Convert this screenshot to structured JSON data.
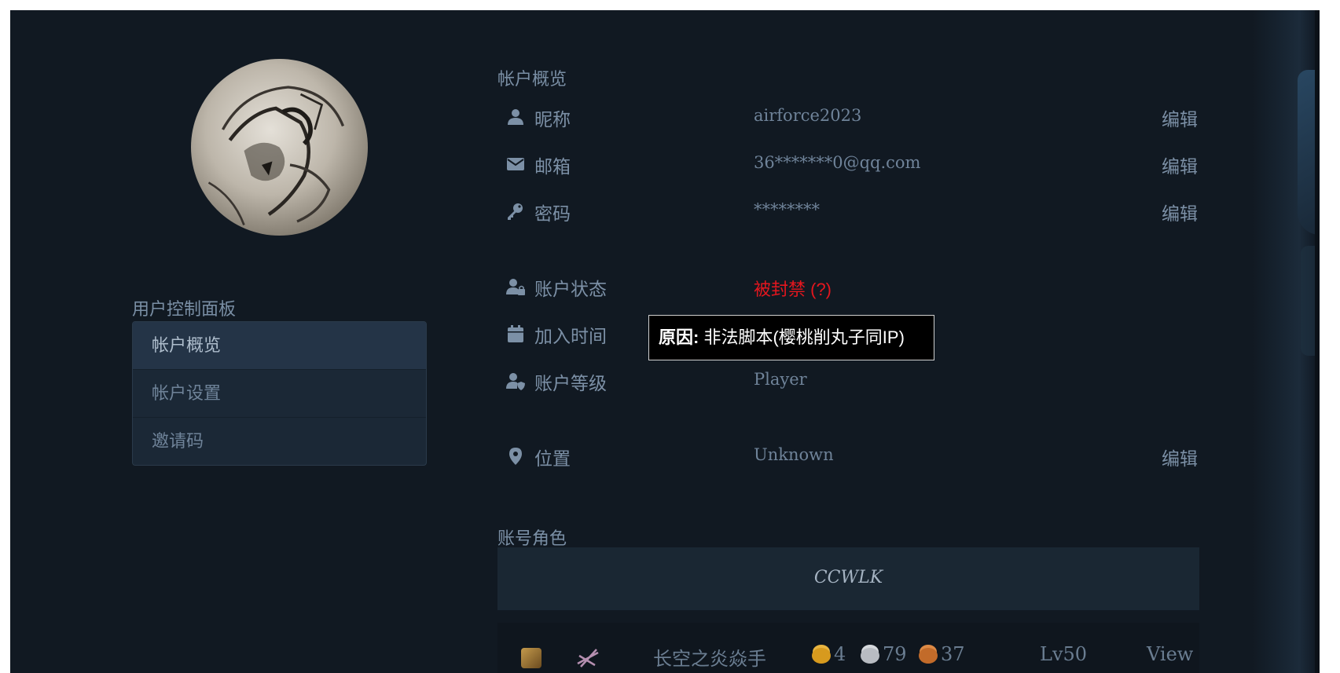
{
  "sidebar": {
    "title": "用户控制面板",
    "items": [
      {
        "label": "帐户概览",
        "active": true
      },
      {
        "label": "帐户设置",
        "active": false
      },
      {
        "label": "邀请码",
        "active": false
      }
    ]
  },
  "overview": {
    "title": "帐户概览",
    "nickname": {
      "label": "昵称",
      "value": "airforce2023",
      "edit": "编辑",
      "icon": "user-icon"
    },
    "email": {
      "label": "邮箱",
      "value": "36*******0@qq.com",
      "edit": "编辑",
      "icon": "envelope-icon"
    },
    "password": {
      "label": "密码",
      "value": "********",
      "edit": "编辑",
      "icon": "key-icon"
    },
    "status": {
      "label": "账户状态",
      "value": "被封禁 (?)",
      "icon": "user-lock-icon",
      "color": "#e4161e"
    },
    "join": {
      "label": "加入时间",
      "icon": "calendar-icon"
    },
    "level": {
      "label": "账户等级",
      "value": "Player",
      "icon": "user-shield-icon"
    },
    "location": {
      "label": "位置",
      "value": "Unknown",
      "edit": "编辑",
      "icon": "map-marker-icon"
    }
  },
  "tooltip": {
    "prefix": "原因:",
    "text": "非法脚本(樱桃削丸子同IP)"
  },
  "characters": {
    "title": "账号角色",
    "realm": "CCWLK",
    "rows": [
      {
        "name": "长空之炎焱手",
        "gold": "4",
        "silver": "79",
        "copper": "37",
        "level": "Lv50",
        "action": "View"
      }
    ]
  }
}
